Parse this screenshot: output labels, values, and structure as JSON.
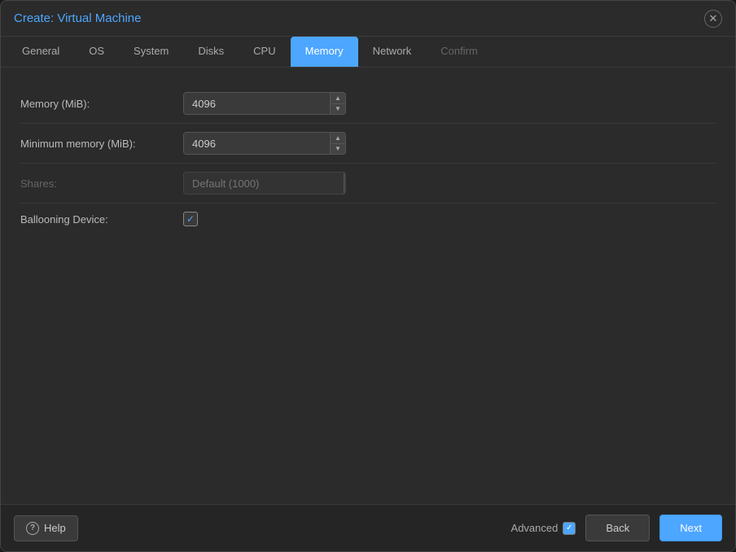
{
  "dialog": {
    "title": "Create: Virtual Machine"
  },
  "tabs": [
    {
      "id": "general",
      "label": "General",
      "active": false,
      "disabled": false
    },
    {
      "id": "os",
      "label": "OS",
      "active": false,
      "disabled": false
    },
    {
      "id": "system",
      "label": "System",
      "active": false,
      "disabled": false
    },
    {
      "id": "disks",
      "label": "Disks",
      "active": false,
      "disabled": false
    },
    {
      "id": "cpu",
      "label": "CPU",
      "active": false,
      "disabled": false
    },
    {
      "id": "memory",
      "label": "Memory",
      "active": true,
      "disabled": false
    },
    {
      "id": "network",
      "label": "Network",
      "active": false,
      "disabled": false
    },
    {
      "id": "confirm",
      "label": "Confirm",
      "active": false,
      "disabled": true
    }
  ],
  "form": {
    "memory_label": "Memory (MiB):",
    "memory_value": "4096",
    "min_memory_label": "Minimum memory (MiB):",
    "min_memory_value": "4096",
    "shares_label": "Shares:",
    "shares_placeholder": "Default (1000)",
    "ballooning_label": "Ballooning Device:"
  },
  "footer": {
    "help_label": "Help",
    "advanced_label": "Advanced",
    "back_label": "Back",
    "next_label": "Next"
  },
  "icons": {
    "close": "✕",
    "check_up": "▲",
    "check_down": "▼",
    "checkmark": "✓",
    "help": "?",
    "adv_check": "✓"
  }
}
